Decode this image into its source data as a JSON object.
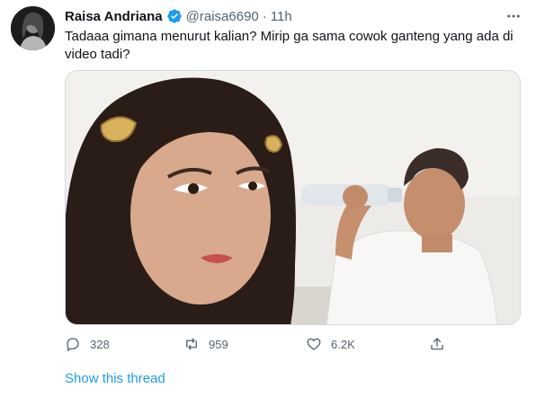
{
  "tweet": {
    "author_name": "Raisa Andriana",
    "handle": "@raisa6690",
    "separator": "·",
    "time": "11h",
    "text": "Tadaaa gimana menurut kalian? Mirip ga sama cowok ganteng yang ada di video tadi?",
    "verified": true,
    "accent_color": "#1d9bf0"
  },
  "actions": {
    "reply_count": "328",
    "retweet_count": "959",
    "like_count": "6.2K"
  },
  "show_thread_label": "Show this thread",
  "icons": [
    "verified-badge-icon",
    "more-options-icon",
    "reply-icon",
    "retweet-icon",
    "like-icon",
    "share-icon"
  ]
}
